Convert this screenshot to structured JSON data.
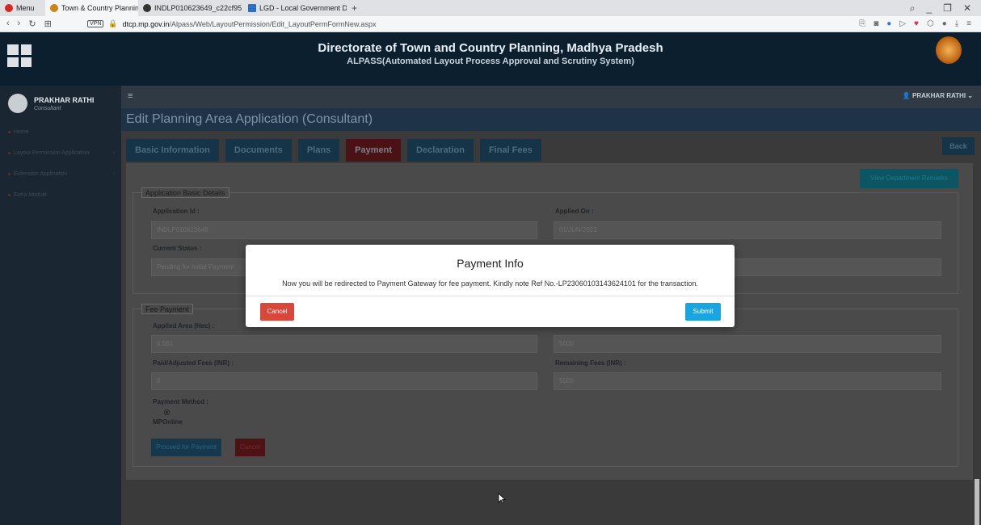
{
  "browser": {
    "menu_label": "Menu",
    "tabs": [
      {
        "label": "Town & Country Planning"
      },
      {
        "label": "INDLP010623649_c22cf95"
      },
      {
        "label": "LGD - Local Government D"
      }
    ],
    "new_tab": "+",
    "url_host": "dtcp.mp.gov.in",
    "url_path": "/Alpass/Web/LayoutPermission/Edit_LayoutPermFormNew.aspx",
    "vpn_label": "VPN"
  },
  "header": {
    "title": "Directorate of Town and Country Planning, Madhya Pradesh",
    "subtitle": "ALPASS(Automated Layout Process Approval and Scrutiny System)"
  },
  "sidebar": {
    "user_name": "PRAKHAR RATHI",
    "user_role": "Consultant",
    "items": [
      {
        "label": "Home"
      },
      {
        "label": "Layout Permission Application"
      },
      {
        "label": "Extension Application"
      },
      {
        "label": "Extra Module"
      }
    ]
  },
  "topbar": {
    "user_label": "PRAKHAR RATHI"
  },
  "page": {
    "title": "Edit Planning Area Application (Consultant)",
    "tabs": [
      {
        "label": "Basic Information"
      },
      {
        "label": "Documents"
      },
      {
        "label": "Plans"
      },
      {
        "label": "Payment"
      },
      {
        "label": "Declaration"
      },
      {
        "label": "Final Fees"
      }
    ],
    "back_label": "Back",
    "remarks_label": "View Department Remarks"
  },
  "basic_details": {
    "legend": "Application Basic Details",
    "application_id_label": "Application Id :",
    "application_id": "INDLP010623649",
    "applied_on_label": "Applied On :",
    "applied_on": "01/JUN/2023",
    "current_status_label": "Current Status :",
    "current_status": "Pending for Initial Payment"
  },
  "fee_payment": {
    "legend": "Fee Payment",
    "applied_area_label": "Applied Area (Hec) :",
    "applied_area": "0.561",
    "total_fees": "5000",
    "paid_fees_label": "Paid/Adjusted Fees (INR) :",
    "paid_fees": "0",
    "remaining_fees_label": "Remaining Fees (INR) :",
    "remaining_fees": "5000",
    "payment_method_label": "Payment Method :",
    "payment_method_option": "MPOnline",
    "proceed_label": "Proceed for Payment",
    "cancel_label": "Cancel"
  },
  "modal": {
    "title": "Payment Info",
    "message": "Now you will be redirected to Payment Gateway for fee payment. Kindly note Ref No.-LP23060103143624101 for the transaction.",
    "cancel_label": "Cancel",
    "submit_label": "Submit"
  },
  "colors": {
    "header_bg": "#0c1f2f",
    "cancel_red": "#d9463a",
    "submit_blue": "#1ba5e0"
  }
}
